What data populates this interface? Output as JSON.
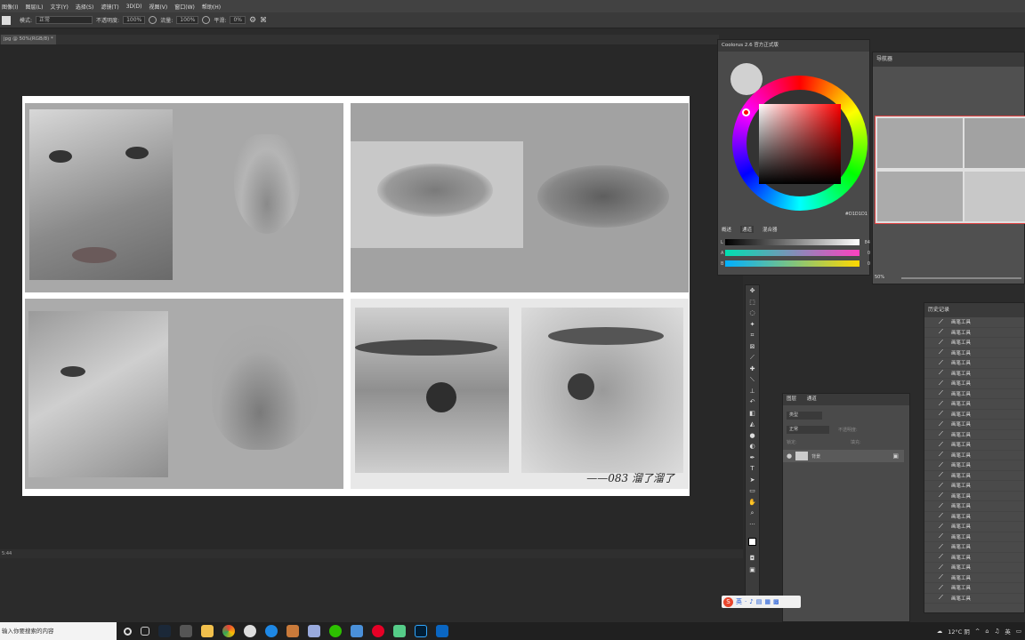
{
  "menu": [
    "图像(I)",
    "图层(L)",
    "文字(Y)",
    "选择(S)",
    "滤镜(T)",
    "3D(D)",
    "视图(V)",
    "窗口(W)",
    "帮助(H)"
  ],
  "options": {
    "mode_label": "模式:",
    "mode_value": "正常",
    "opacity_label": "不透明度:",
    "opacity_value": "100%",
    "flow_label": "流量:",
    "flow_value": "100%",
    "smooth_label": "平滑:",
    "smooth_value": "0%"
  },
  "document": {
    "tab_title": "jpg @ 50%(RGB/8) *"
  },
  "artwork": {
    "signature": "——083 溜了溜了"
  },
  "statusbar": {
    "text": "5:44"
  },
  "coolorus": {
    "title": "Coolorus 2.6 官方正式版",
    "hex_value": "#D1D1D1",
    "tabs": [
      "概述",
      "通道",
      "混合器"
    ],
    "sliders": [
      {
        "label": "L",
        "value": "84"
      },
      {
        "label": "A",
        "value": "0"
      },
      {
        "label": "B",
        "value": "0"
      }
    ]
  },
  "navigator": {
    "title": "导航器",
    "zoom": "50%"
  },
  "layers": {
    "tabs": [
      "图层",
      "通道"
    ],
    "kind_label": "类型",
    "blend_mode": "正常",
    "opacity_label": "不透明度:",
    "lock_label": "锁定:",
    "fill_label": "填充:",
    "layer_name": "背景"
  },
  "history": {
    "title": "历史记录",
    "item_label": "画笔工具",
    "count": 28
  },
  "taskbar": {
    "search_placeholder": "输入你要搜索的内容",
    "weather": "12°C 阴",
    "ime_label": "英"
  },
  "colors": {
    "accent_ring": "#ff0000",
    "taskbar": "#202020",
    "panel": "#4a4a4a"
  }
}
